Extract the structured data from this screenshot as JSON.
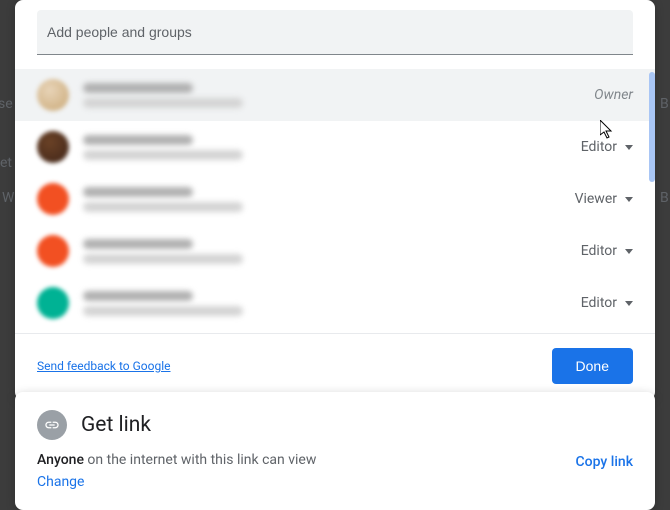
{
  "share": {
    "search_placeholder": "Add people and groups",
    "people": [
      {
        "role": "Owner",
        "dropdown": false
      },
      {
        "role": "Editor",
        "dropdown": true
      },
      {
        "role": "Viewer",
        "dropdown": true
      },
      {
        "role": "Editor",
        "dropdown": true
      },
      {
        "role": "Editor",
        "dropdown": true
      }
    ],
    "feedback_label": "Send feedback to Google",
    "done_label": "Done"
  },
  "getlink": {
    "title": "Get link",
    "desc_bold": "Anyone",
    "desc_rest": " on the internet with this link can view",
    "change_label": "Change",
    "copy_label": "Copy link"
  }
}
